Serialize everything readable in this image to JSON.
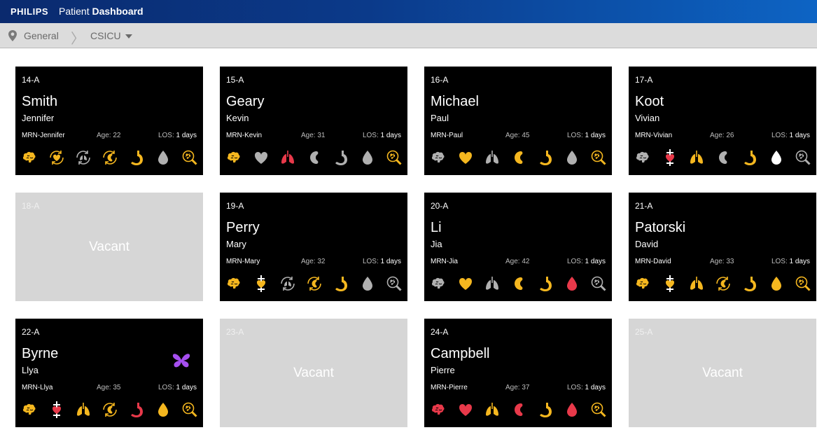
{
  "app": {
    "brand": "PHILIPS",
    "title_prefix": "Patient",
    "title_main": "Dashboard"
  },
  "breadcrumb": {
    "location": "General",
    "unit": "CSICU"
  },
  "colors": {
    "yellow": "#f5b71f",
    "gray": "#b0b0b0",
    "red": "#e8394a",
    "purple": "#a64ff0",
    "white": "#ffffff"
  },
  "labels": {
    "age": "Age:",
    "los": "LOS:"
  },
  "beds": [
    {
      "bed": "14-A",
      "vacant": false,
      "last": "Smith",
      "first": "Jennifer",
      "mrn": "MRN-Jennifer",
      "age": "22",
      "los": "1 days",
      "icons": [
        [
          "brain",
          "yellow"
        ],
        [
          "heart-cycle",
          "yellow"
        ],
        [
          "lungs-cycle",
          "gray"
        ],
        [
          "kidney-cycle",
          "yellow"
        ],
        [
          "stomach",
          "yellow"
        ],
        [
          "drop",
          "gray"
        ],
        [
          "search-cell",
          "yellow"
        ]
      ]
    },
    {
      "bed": "15-A",
      "vacant": false,
      "last": "Geary",
      "first": "Kevin",
      "mrn": "MRN-Kevin",
      "age": "31",
      "los": "1 days",
      "icons": [
        [
          "brain",
          "yellow"
        ],
        [
          "heart",
          "gray"
        ],
        [
          "lungs",
          "red"
        ],
        [
          "kidney",
          "gray"
        ],
        [
          "stomach",
          "gray"
        ],
        [
          "drop",
          "gray"
        ],
        [
          "search-cell",
          "yellow"
        ]
      ]
    },
    {
      "bed": "16-A",
      "vacant": false,
      "last": "Michael",
      "first": "Paul",
      "mrn": "MRN-Paul",
      "age": "45",
      "los": "1 days",
      "icons": [
        [
          "brain",
          "gray"
        ],
        [
          "heart",
          "yellow"
        ],
        [
          "lungs",
          "gray"
        ],
        [
          "kidney",
          "yellow"
        ],
        [
          "stomach",
          "yellow"
        ],
        [
          "drop",
          "gray"
        ],
        [
          "search-cell",
          "yellow"
        ]
      ]
    },
    {
      "bed": "17-A",
      "vacant": false,
      "last": "Koot",
      "first": "Vivian",
      "mrn": "MRN-Vivian",
      "age": "26",
      "los": "1 days",
      "icons": [
        [
          "brain",
          "gray"
        ],
        [
          "heart-device",
          "red"
        ],
        [
          "lungs",
          "yellow"
        ],
        [
          "kidney",
          "gray"
        ],
        [
          "stomach",
          "yellow"
        ],
        [
          "drop",
          "white"
        ],
        [
          "search-cell",
          "gray"
        ]
      ]
    },
    {
      "bed": "18-A",
      "vacant": true,
      "vacant_label": "Vacant"
    },
    {
      "bed": "19-A",
      "vacant": false,
      "last": "Perry",
      "first": "Mary",
      "mrn": "MRN-Mary",
      "age": "32",
      "los": "1 days",
      "icons": [
        [
          "brain",
          "yellow"
        ],
        [
          "heart-device",
          "yellow"
        ],
        [
          "lungs-cycle",
          "gray"
        ],
        [
          "kidney-cycle",
          "yellow"
        ],
        [
          "stomach",
          "yellow"
        ],
        [
          "drop",
          "gray"
        ],
        [
          "search-cell",
          "gray"
        ]
      ]
    },
    {
      "bed": "20-A",
      "vacant": false,
      "last": "Li",
      "first": "Jia",
      "mrn": "MRN-Jia",
      "age": "42",
      "los": "1 days",
      "icons": [
        [
          "brain",
          "gray"
        ],
        [
          "heart",
          "yellow"
        ],
        [
          "lungs",
          "gray"
        ],
        [
          "kidney",
          "yellow"
        ],
        [
          "stomach",
          "yellow"
        ],
        [
          "drop",
          "red"
        ],
        [
          "search-cell",
          "gray"
        ]
      ]
    },
    {
      "bed": "21-A",
      "vacant": false,
      "last": "Patorski",
      "first": "David",
      "mrn": "MRN-David",
      "age": "33",
      "los": "1 days",
      "icons": [
        [
          "brain",
          "yellow"
        ],
        [
          "heart-device",
          "yellow"
        ],
        [
          "lungs",
          "yellow"
        ],
        [
          "kidney-cycle",
          "yellow"
        ],
        [
          "stomach",
          "yellow"
        ],
        [
          "drop",
          "yellow"
        ],
        [
          "search-cell",
          "yellow"
        ]
      ]
    },
    {
      "bed": "22-A",
      "vacant": false,
      "last": "Byrne",
      "first": "Llya",
      "mrn": "MRN-Llya",
      "age": "35",
      "los": "1 days",
      "flag": true,
      "icons": [
        [
          "brain",
          "yellow"
        ],
        [
          "heart-device",
          "red"
        ],
        [
          "lungs",
          "yellow"
        ],
        [
          "kidney-cycle",
          "yellow"
        ],
        [
          "stomach",
          "red"
        ],
        [
          "drop",
          "yellow"
        ],
        [
          "search-cell",
          "yellow"
        ]
      ]
    },
    {
      "bed": "23-A",
      "vacant": true,
      "vacant_label": "Vacant"
    },
    {
      "bed": "24-A",
      "vacant": false,
      "last": "Campbell",
      "first": "Pierre",
      "mrn": "MRN-Pierre",
      "age": "37",
      "los": "1 days",
      "icons": [
        [
          "brain",
          "red"
        ],
        [
          "heart",
          "red"
        ],
        [
          "lungs",
          "yellow"
        ],
        [
          "kidney",
          "red"
        ],
        [
          "stomach",
          "yellow"
        ],
        [
          "drop",
          "red"
        ],
        [
          "search-cell",
          "yellow"
        ]
      ]
    },
    {
      "bed": "25-A",
      "vacant": true,
      "vacant_label": "Vacant"
    }
  ]
}
